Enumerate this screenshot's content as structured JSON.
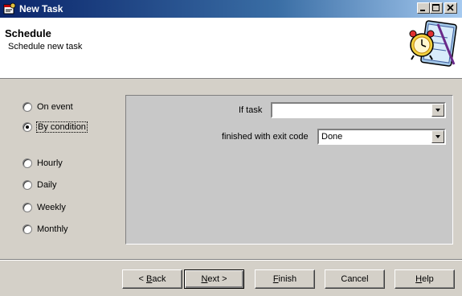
{
  "window": {
    "title": "New Task"
  },
  "titlebar_buttons": [
    "minimize",
    "maximize",
    "close"
  ],
  "header": {
    "title": "Schedule",
    "subtitle": "Schedule new task"
  },
  "schedule_options": [
    {
      "label": "On event",
      "checked": false
    },
    {
      "label": "By condition",
      "checked": true
    },
    {
      "label": "Hourly",
      "checked": false
    },
    {
      "label": "Daily",
      "checked": false
    },
    {
      "label": "Weekly",
      "checked": false
    },
    {
      "label": "Monthly",
      "checked": false
    }
  ],
  "condition": {
    "if_task_label": "If task",
    "if_task_value": "",
    "exit_code_label": "finished with exit code",
    "exit_code_value": "Done"
  },
  "buttons": {
    "back": {
      "prefix": "< ",
      "mnemonic": "B",
      "rest": "ack"
    },
    "next": {
      "mnemonic": "N",
      "rest": "ext >"
    },
    "finish": {
      "mnemonic": "F",
      "rest": "inish"
    },
    "cancel": "Cancel",
    "help": {
      "mnemonic": "H",
      "rest": "elp"
    }
  },
  "icons": {
    "app": "task-app-icon",
    "wizard": "alarm-clock-notebook-icon"
  }
}
